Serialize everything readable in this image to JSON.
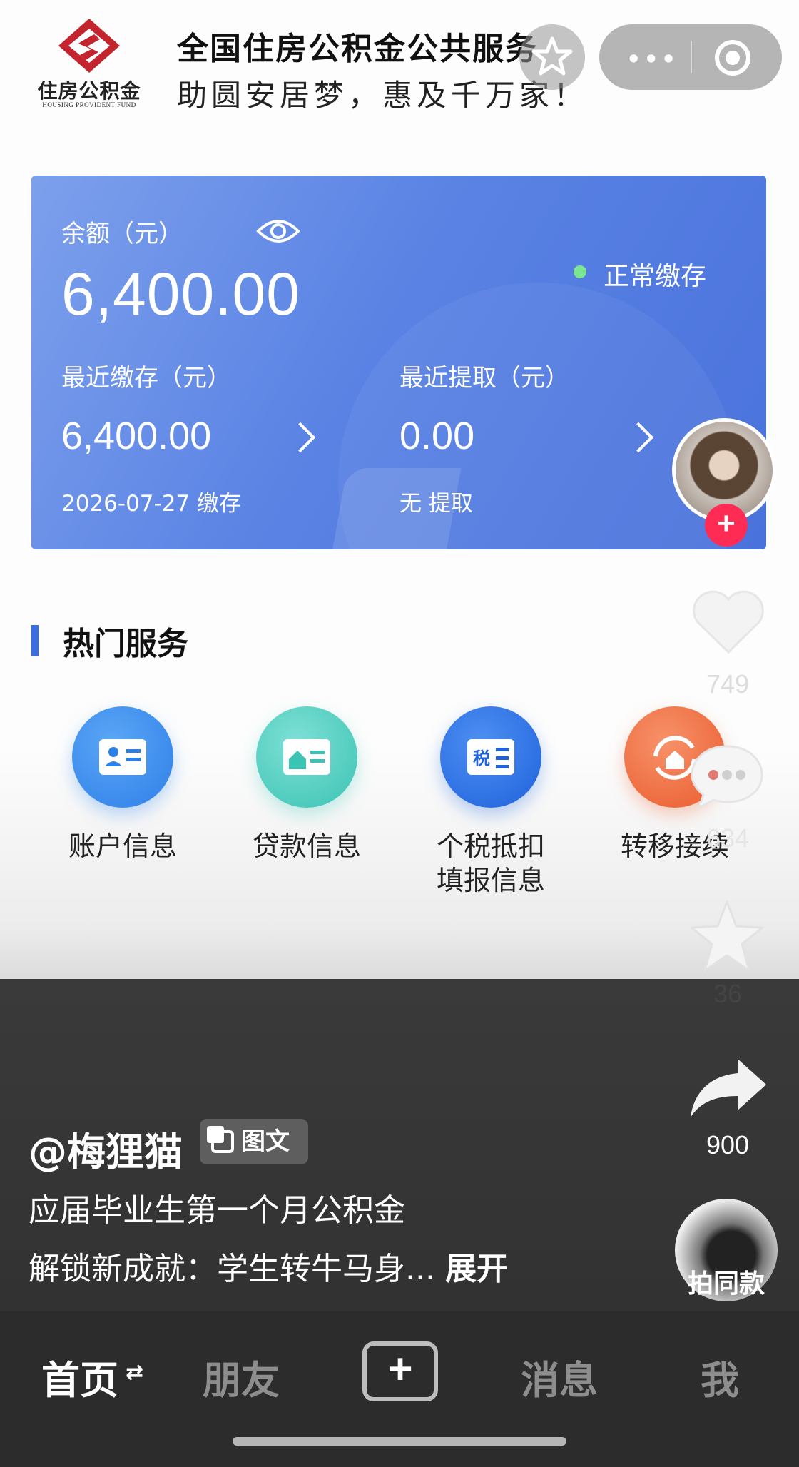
{
  "header": {
    "logo_text": "住房公积金",
    "logo_sub": "HOUSING PROVIDENT FUND",
    "title": "全国住房公积金公共服务",
    "subtitle": "助圆安居梦，惠及千万家！"
  },
  "capsule": {
    "more": "•••"
  },
  "card": {
    "balance_label": "余额（元）",
    "balance": "6,400.00",
    "status": "正常缴存",
    "recent_deposit_label": "最近缴存（元）",
    "recent_deposit": "6,400.00",
    "recent_deposit_note": "2026-07-27 缴存",
    "recent_withdraw_label": "最近提取（元）",
    "recent_withdraw": "0.00",
    "recent_withdraw_note": "无 提取",
    "status_color": "#7be58f"
  },
  "services": {
    "title": "热门服务",
    "items": [
      {
        "label": "账户信息",
        "icon": "id-card-icon",
        "color": "#3d8ef0"
      },
      {
        "label": "贷款信息",
        "icon": "house-card-icon",
        "color": "#4ccfc0"
      },
      {
        "label": "个税抵扣\n填报信息",
        "icon": "tax-icon",
        "color": "#2f74e6"
      },
      {
        "label": "转移接续",
        "icon": "transfer-icon",
        "color": "#f07447"
      }
    ]
  },
  "rail": {
    "likes": "749",
    "comments": "634",
    "favorites": "36",
    "shares": "900",
    "music_label": "拍同款",
    "follow": "+"
  },
  "post": {
    "author": "@梅狸猫",
    "badge": "图文",
    "line1": "应届毕业生第一个月公积金",
    "line2": "解锁新成就：学生转牛马身...",
    "expand": "展开"
  },
  "nav": {
    "home": "首页",
    "friends": "朋友",
    "add": "+",
    "messages": "消息",
    "me": "我"
  }
}
